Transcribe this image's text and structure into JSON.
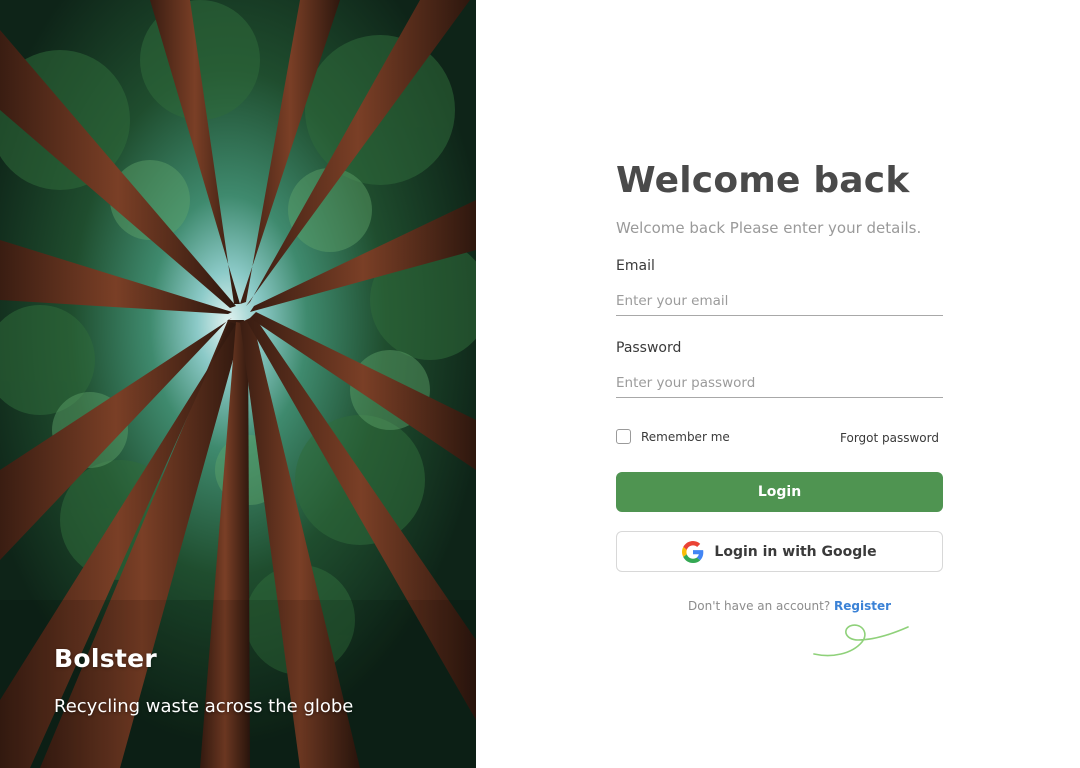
{
  "hero": {
    "brand": "Bolster",
    "tagline": "Recycling waste across the globe"
  },
  "form": {
    "title": "Welcome back",
    "subtitle": "Welcome back Please enter your details.",
    "email": {
      "label": "Email",
      "placeholder": "Enter your email",
      "value": ""
    },
    "password": {
      "label": "Password",
      "placeholder": "Enter your password",
      "value": ""
    },
    "remember_label": "Remember me",
    "remember_checked": false,
    "forgot_label": "Forgot password",
    "login_label": "Login",
    "google_label": "Login in with Google",
    "no_account_text": "Don't have an account?",
    "register_label": "Register"
  },
  "colors": {
    "primary_green": "#4f9451",
    "link_blue": "#3b82d6",
    "title_gray": "#4a4a4a",
    "swirl_green": "#8fd17a"
  },
  "icons": {
    "google": "google-g-icon",
    "checkbox": "checkbox-icon",
    "decoration": "swirl-decoration"
  }
}
